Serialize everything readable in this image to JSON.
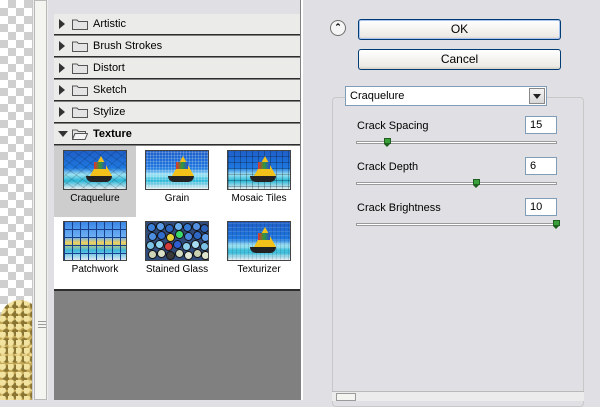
{
  "gallery": {
    "categories": [
      {
        "label": "Artistic",
        "expanded": false
      },
      {
        "label": "Brush Strokes",
        "expanded": false
      },
      {
        "label": "Distort",
        "expanded": false
      },
      {
        "label": "Sketch",
        "expanded": false
      },
      {
        "label": "Stylize",
        "expanded": false
      },
      {
        "label": "Texture",
        "expanded": true
      }
    ],
    "thumbnails": [
      {
        "label": "Craquelure",
        "selected": true
      },
      {
        "label": "Grain",
        "selected": false
      },
      {
        "label": "Mosaic Tiles",
        "selected": false
      },
      {
        "label": "Patchwork",
        "selected": false
      },
      {
        "label": "Stained Glass",
        "selected": false
      },
      {
        "label": "Texturizer",
        "selected": false
      }
    ]
  },
  "buttons": {
    "ok": "OK",
    "cancel": "Cancel"
  },
  "filter": {
    "selected": "Craquelure"
  },
  "params": [
    {
      "label": "Crack Spacing",
      "value": "15",
      "slider_fraction": 0.15
    },
    {
      "label": "Crack Depth",
      "value": "6",
      "slider_fraction": 0.6
    },
    {
      "label": "Crack Brightness",
      "value": "10",
      "slider_fraction": 1.0
    }
  ],
  "colors": {
    "panel_bg": "#e0dfe3",
    "gallery_bg": "#808080",
    "button_border": "#003c74",
    "slider_knob": "#3aa03a"
  }
}
